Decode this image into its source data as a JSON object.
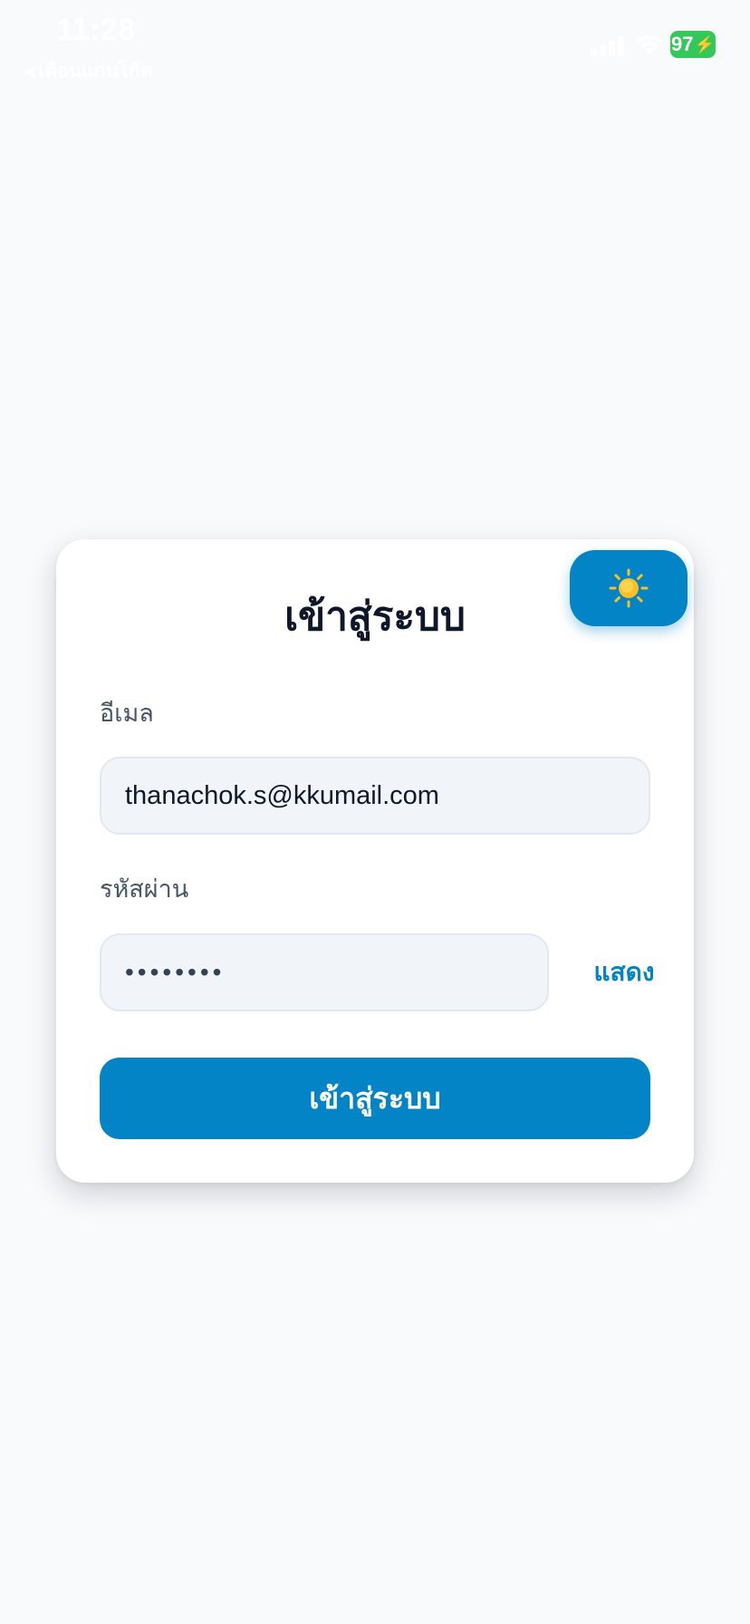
{
  "status_bar": {
    "time": "11:28",
    "back_app_label": "เตือนแก่นโก้ต",
    "battery_level": "97",
    "signal_icon": "cellular-signal-icon",
    "wifi_icon": "wifi-icon",
    "charging_icon": "charging-bolt-icon"
  },
  "login_card": {
    "title": "เข้าสู่ระบบ",
    "theme_toggle_icon": "sun-icon",
    "email": {
      "label": "อีเมล",
      "value": "thanachok.s@kkumail.com"
    },
    "password": {
      "label": "รหัสผ่าน",
      "masked_value": "••••••••",
      "show_label": "แสดง"
    },
    "submit_label": "เข้าสู่ระบบ"
  },
  "colors": {
    "accent": "#0284c7",
    "background": "#f8fafc",
    "card": "#ffffff",
    "input_bg": "#f1f5f9",
    "battery": "#34c759"
  }
}
